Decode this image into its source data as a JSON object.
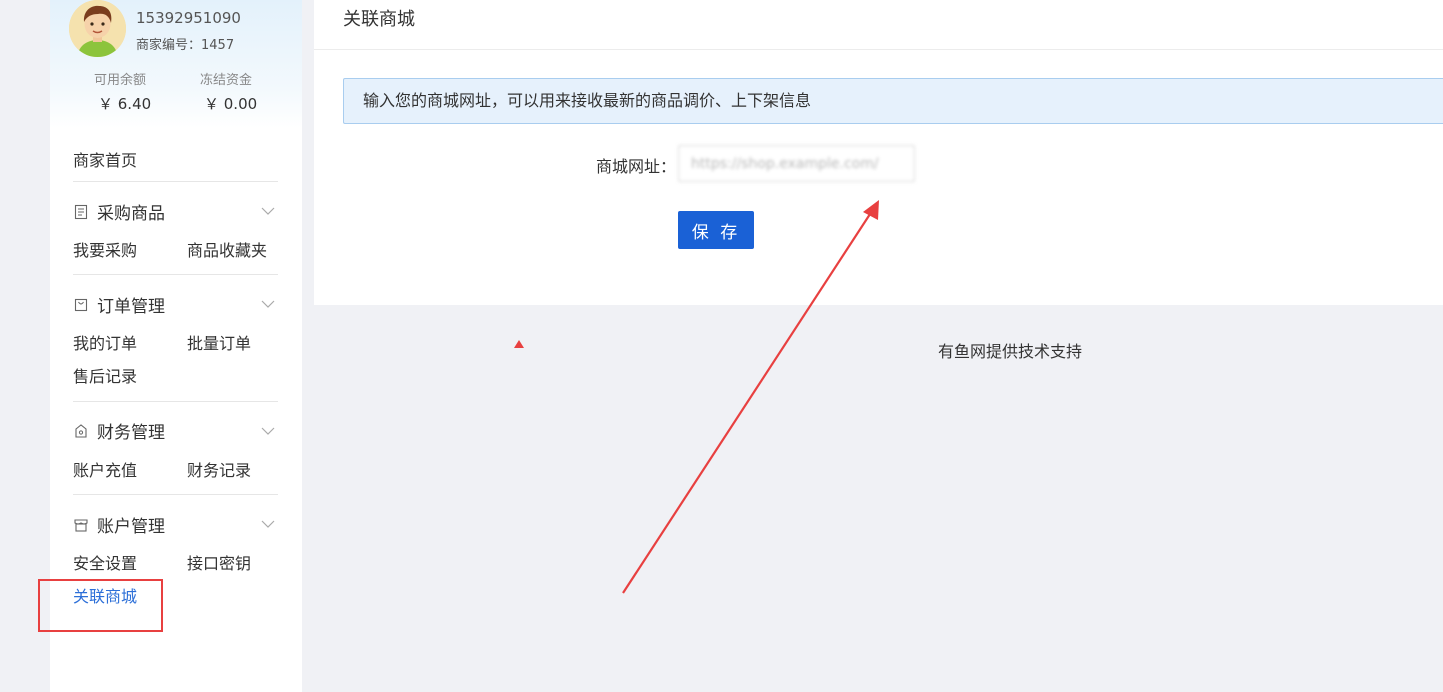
{
  "profile": {
    "phone": "15392951090",
    "merchant_id": "商家编号：1457",
    "available_label": "可用余额",
    "available_value": "￥ 6.40",
    "frozen_label": "冻结资金",
    "frozen_value": "￥ 0.00"
  },
  "sidebar": {
    "home": "商家首页",
    "groups": [
      {
        "title": "采购商品",
        "icon": "document-icon",
        "items": [
          "我要采购",
          "商品收藏夹"
        ]
      },
      {
        "title": "订单管理",
        "icon": "bag-icon",
        "items": [
          "我的订单",
          "批量订单",
          "售后记录"
        ]
      },
      {
        "title": "财务管理",
        "icon": "wallet-icon",
        "items": [
          "账户充值",
          "财务记录"
        ]
      },
      {
        "title": "账户管理",
        "icon": "store-icon",
        "items": [
          "安全设置",
          "接口密钥",
          "关联商城"
        ]
      }
    ],
    "active_item": "关联商城"
  },
  "main": {
    "title": "关联商城",
    "notice": "输入您的商城网址，可以用来接收最新的商品调价、上下架信息",
    "url_label": "商城网址：",
    "url_value": "https://shop.example.com/",
    "save_label": "保 存"
  },
  "footer": "有鱼网提供技术支持",
  "colors": {
    "accent": "#1a61d6",
    "active_link": "#2c6fd8",
    "annotation": "#e84040",
    "notice_bg": "#e6f1fc"
  }
}
